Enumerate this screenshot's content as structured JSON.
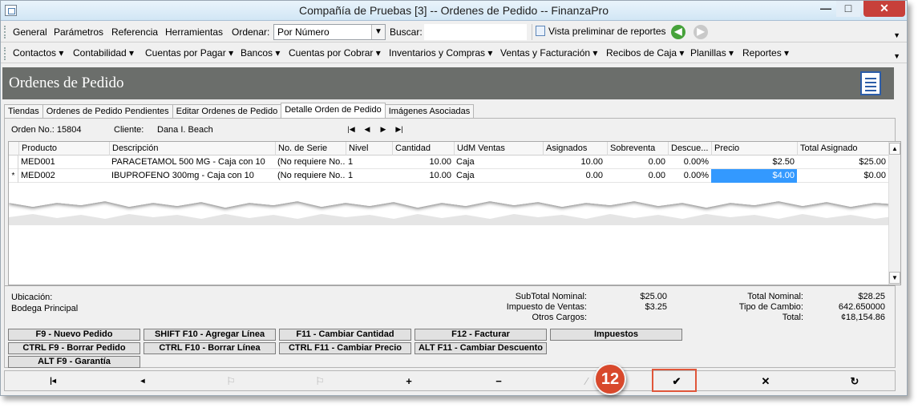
{
  "window": {
    "title": "Compañía de Pruebas [3] -- Ordenes de Pedido -- FinanzaPro",
    "min": "—",
    "max": "□",
    "close": "✕"
  },
  "menu": {
    "items": [
      "General",
      "Parámetros",
      "Referencia",
      "Herramientas"
    ],
    "order_label": "Ordenar:",
    "order_value": "Por Número",
    "search_label": "Buscar:",
    "preview_label": "Vista preliminar de reportes"
  },
  "nav": {
    "items": [
      "Contactos ▾",
      "Contabilidad ▾",
      "Cuentas por Pagar ▾",
      "Bancos ▾",
      "Cuentas por Cobrar ▾",
      "Inventarios y Compras ▾",
      "Ventas y Facturación ▾",
      "Recibos de Caja ▾",
      "Planillas ▾",
      "Reportes ▾"
    ]
  },
  "page": {
    "title": "Ordenes de Pedido"
  },
  "tabs": [
    "Tiendas",
    "Ordenes de Pedido Pendientes",
    "Editar Ordenes de Pedido",
    "Detalle Orden de Pedido",
    "Imágenes Asociadas"
  ],
  "order": {
    "label": "Orden No.: 15804",
    "client_label": "Cliente:",
    "client_value": "Dana I. Beach"
  },
  "grid": {
    "columns": [
      "Producto",
      "Descripción",
      "No. de Serie",
      "Nivel",
      "Cantidad",
      "UdM Ventas",
      "Asignados",
      "Sobreventa",
      "Descue...",
      "Precio",
      "Total Asignado"
    ],
    "rows": [
      {
        "marker": "",
        "cells": [
          "MED001",
          "PARACETAMOL 500 MG - Caja con 10",
          "(No requiere No...",
          "1",
          "10.00",
          "Caja",
          "10.00",
          "0.00",
          "0.00%",
          "$2.50",
          "$25.00"
        ]
      },
      {
        "marker": "*",
        "cells": [
          "MED002",
          "IBUPROFENO 300mg - Caja con 10",
          "(No requiere No...",
          "1",
          "10.00",
          "Caja",
          "0.00",
          "0.00",
          "0.00%",
          "$4.00",
          "$0.00"
        ]
      }
    ]
  },
  "totals": {
    "location_label": "Ubicación:",
    "location_value": "Bodega Principal",
    "subtotal_label": "SubTotal Nominal:",
    "subtotal_value": "$25.00",
    "tax_label": "Impuesto de Ventas:",
    "tax_value": "$3.25",
    "other_label": "Otros Cargos:",
    "total_nominal_label": "Total Nominal:",
    "total_nominal_value": "$28.25",
    "rate_label": "Tipo de Cambio:",
    "rate_value": "642.650000",
    "total_label": "Total:",
    "total_value": "¢18,154.86"
  },
  "actions": {
    "new_order": "F9 - Nuevo Pedido",
    "add_line": "SHIFT F10 - Agregar Línea",
    "change_qty": "F11 - Cambiar Cantidad",
    "invoice": "F12 - Facturar",
    "taxes": "Impuestos",
    "delete_order": "CTRL F9 - Borrar Pedido",
    "delete_line": "CTRL F10 - Borrar Línea",
    "change_price": "CTRL F11 - Cambiar Precio",
    "change_discount": "ALT F11 - Cambiar Descuento",
    "warranty": "ALT F9 - Garantía"
  },
  "bottombar": {
    "first": "|◂",
    "prev": "◂",
    "next_flag": "⚐",
    "last_flag": "⚐",
    "add": "+",
    "remove": "−",
    "edit": "⁄",
    "confirm": "✔",
    "cancel": "✕",
    "refresh": "↻"
  },
  "callout": {
    "step": "12"
  },
  "colors": {
    "banner": "#6b6e6b",
    "selection": "#3399ff",
    "callout": "#d8492c"
  }
}
